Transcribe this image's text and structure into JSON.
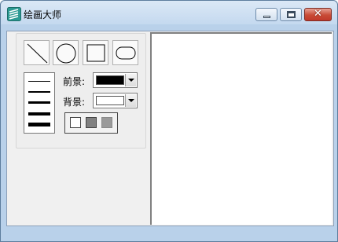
{
  "window": {
    "title": "绘画大师"
  },
  "titlebar": {
    "close_glyph": "✕"
  },
  "tools": {
    "shapes": [
      {
        "icon": "line-icon"
      },
      {
        "icon": "circle-icon"
      },
      {
        "icon": "rectangle-icon"
      },
      {
        "icon": "rounded-rectangle-icon"
      }
    ],
    "line_widths": [
      1,
      2,
      3,
      4,
      5
    ]
  },
  "foreground": {
    "label": "前景:",
    "color": "#000000"
  },
  "background": {
    "label": "背景:",
    "color": "#ffffff"
  },
  "fill_styles": [
    {
      "icon": "no-fill-icon",
      "color": "#ffffff"
    },
    {
      "icon": "gray-fill-icon",
      "color": "#808080"
    },
    {
      "icon": "light-gray-fill-icon",
      "color": "#9a9a9a"
    }
  ],
  "colors": {
    "titlebar": "#c4d9ef",
    "client_bg": "#f0f0f0",
    "canvas_bg": "#ffffff",
    "close_button": "#c84b36"
  }
}
